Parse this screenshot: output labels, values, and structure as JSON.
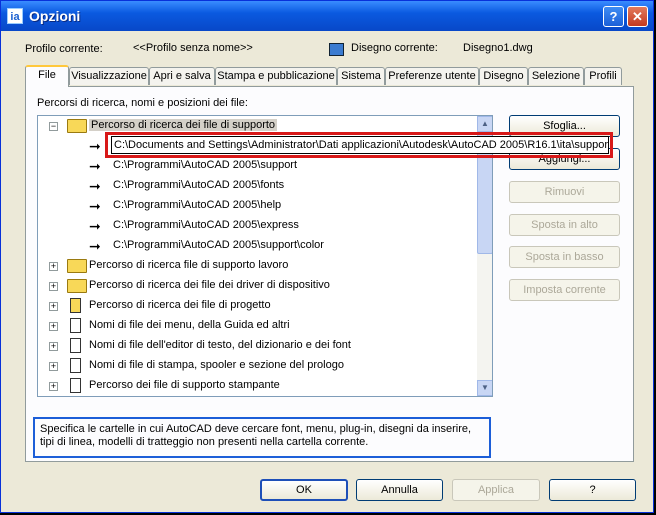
{
  "window": {
    "title": "Opzioni",
    "help_glyph": "?",
    "close_glyph": "✕",
    "app_icon": "autocad-icon"
  },
  "header": {
    "profile_label": "Profilo corrente:",
    "profile_value": "<<Profilo senza nome>>",
    "drawing_label": "Disegno corrente:",
    "drawing_value": "Disegno1.dwg"
  },
  "tabs": [
    "File",
    "Visualizzazione",
    "Apri e salva",
    "Stampa e pubblicazione",
    "Sistema",
    "Preferenze utente",
    "Disegno",
    "Selezione",
    "Profili"
  ],
  "panel": {
    "heading": "Percorsi di ricerca, nomi e posizioni dei file:"
  },
  "tree": {
    "root": "Percorso di ricerca dei file di supporto",
    "edit_value": "C:\\Documents and Settings\\Administrator\\Dati applicazioni\\Autodesk\\AutoCAD 2005\\R16.1\\ita\\support",
    "children": [
      "C:\\Programmi\\AutoCAD 2005\\support",
      "C:\\Programmi\\AutoCAD 2005\\fonts",
      "C:\\Programmi\\AutoCAD 2005\\help",
      "C:\\Programmi\\AutoCAD 2005\\express",
      "C:\\Programmi\\AutoCAD 2005\\support\\color"
    ],
    "others": [
      "Percorso di ricerca file di supporto lavoro",
      "Percorso di ricerca dei file dei driver di dispositivo",
      "Percorso di ricerca dei file di progetto",
      "Nomi di file dei menu, della Guida ed altri",
      "Nomi di file dell'editor di testo, del dizionario e dei font",
      "Nomi di file di stampa, spooler e sezione del prologo",
      "Percorso dei file di supporto stampante"
    ]
  },
  "side_buttons": {
    "browse": "Sfoglia...",
    "add": "Aggiungi...",
    "remove": "Rimuovi",
    "move_up": "Sposta in alto",
    "move_down": "Sposta in basso",
    "set_current": "Imposta corrente"
  },
  "description": "Specifica le cartelle in cui AutoCAD deve cercare font, menu, plug-in, disegni da inserire, tipi di linea, modelli di tratteggio non presenti nella cartella corrente.",
  "footer": {
    "ok": "OK",
    "cancel": "Annulla",
    "apply": "Applica",
    "help": "?"
  }
}
